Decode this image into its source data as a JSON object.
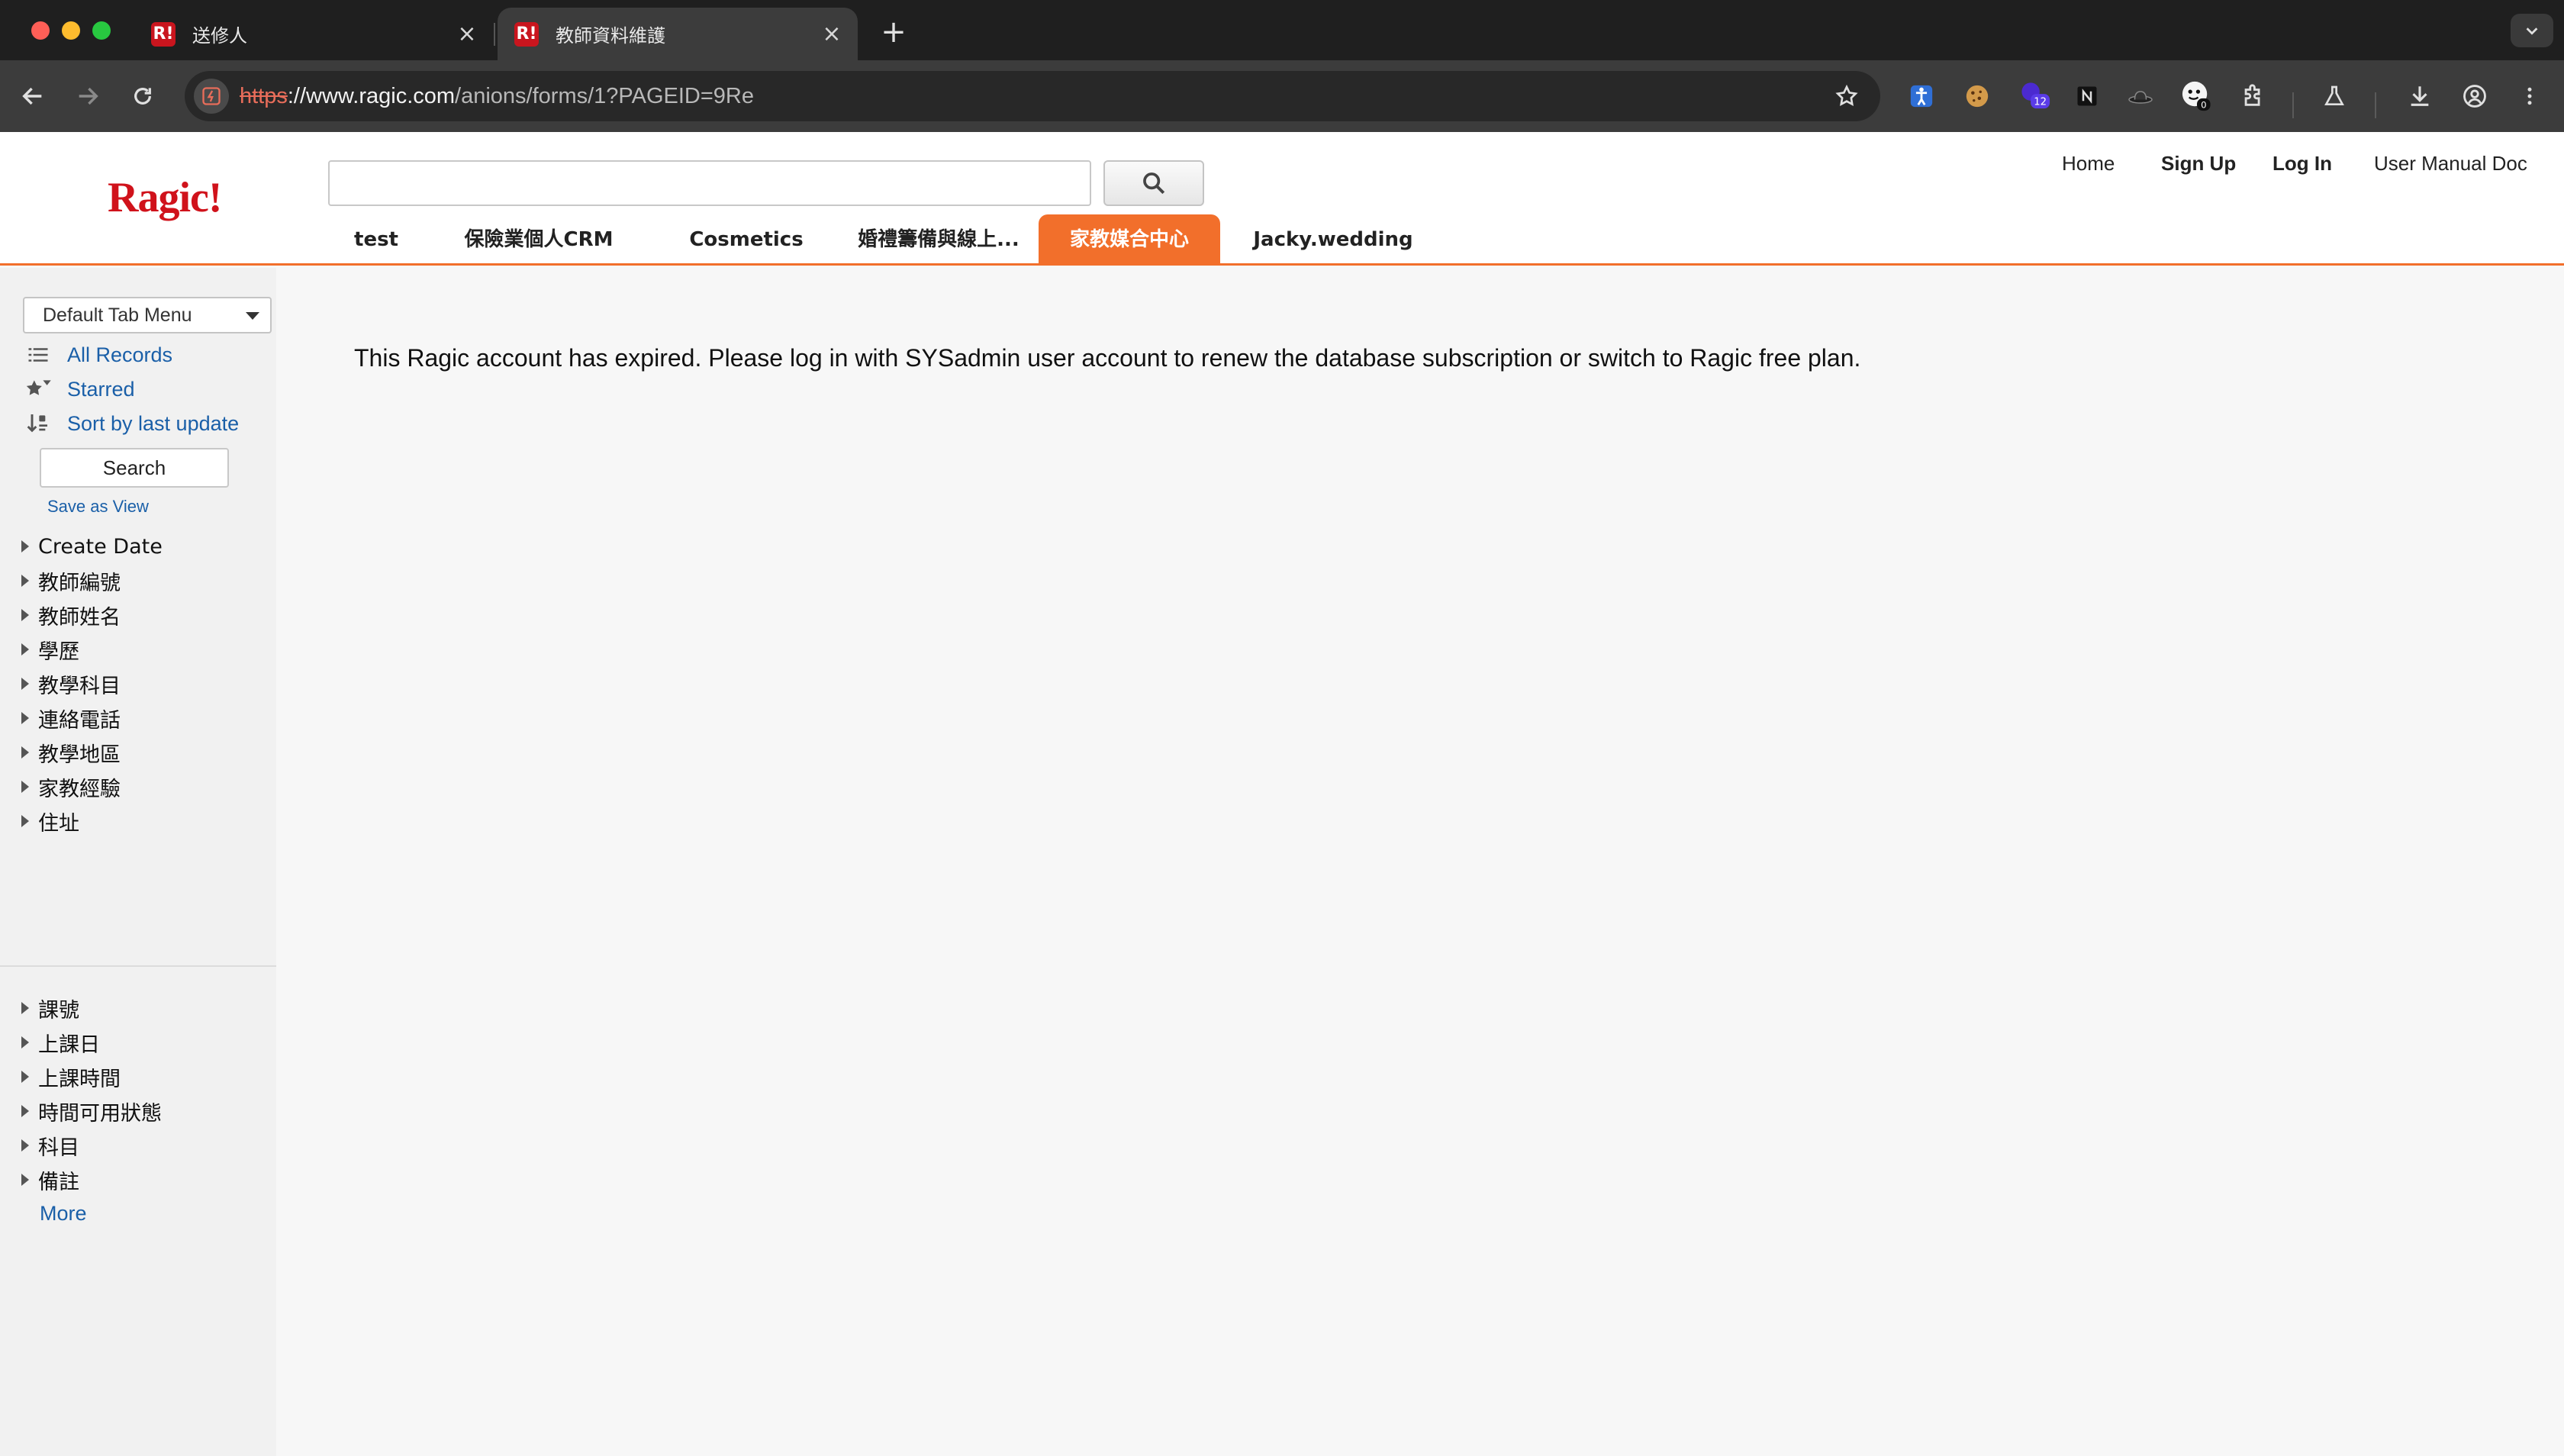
{
  "browser": {
    "tabs": [
      {
        "title": "送修人",
        "favicon": "R!",
        "active": false
      },
      {
        "title": "教師資料維護",
        "favicon": "R!",
        "active": true
      }
    ],
    "url": {
      "scheme": "https",
      "host": "://www.ragic.com",
      "path": "/anions/forms/1?PAGEID=9Re"
    },
    "new_tab_icon": "+",
    "extensions": [
      "accessibility-icon",
      "cookie-icon",
      "badge-extension-icon",
      "notion-icon",
      "hat-icon",
      "smiley-extension-icon",
      "puzzle-icon",
      "lab-icon",
      "download-icon",
      "profile-icon",
      "kebab-menu-icon"
    ],
    "extension_badge_12": "12",
    "extension_badge_0": "0"
  },
  "header": {
    "logo": "Ragic!",
    "top_links": {
      "home": "Home",
      "signup": "Sign Up",
      "login": "Log In",
      "manual": "User Manual Doc"
    },
    "nav_tabs": [
      "test",
      "保險業個人CRM",
      "Cosmetics",
      "婚禮籌備與線上...",
      "家教媒合中心",
      "Jacky.wedding"
    ],
    "active_tab": "家教媒合中心",
    "accent_color": "#f26f2b"
  },
  "sidebar": {
    "tab_menu": "Default Tab Menu",
    "links": {
      "all_records": "All Records",
      "starred": "Starred",
      "sort": "Sort by last update"
    },
    "search_button": "Search",
    "save_view": "Save as View",
    "fields_group1": [
      "Create Date",
      "教師編號",
      "教師姓名",
      "學歷",
      "教學科目",
      "連絡電話",
      "教學地區",
      "家教經驗",
      "住址"
    ],
    "fields_group2": [
      "課號",
      "上課日",
      "上課時間",
      "時間可用狀態",
      "科目",
      "備註"
    ],
    "more": "More"
  },
  "main": {
    "message": "This Ragic account has expired. Please log in with SYSadmin user account to renew the database subscription or switch to Ragic free plan."
  }
}
